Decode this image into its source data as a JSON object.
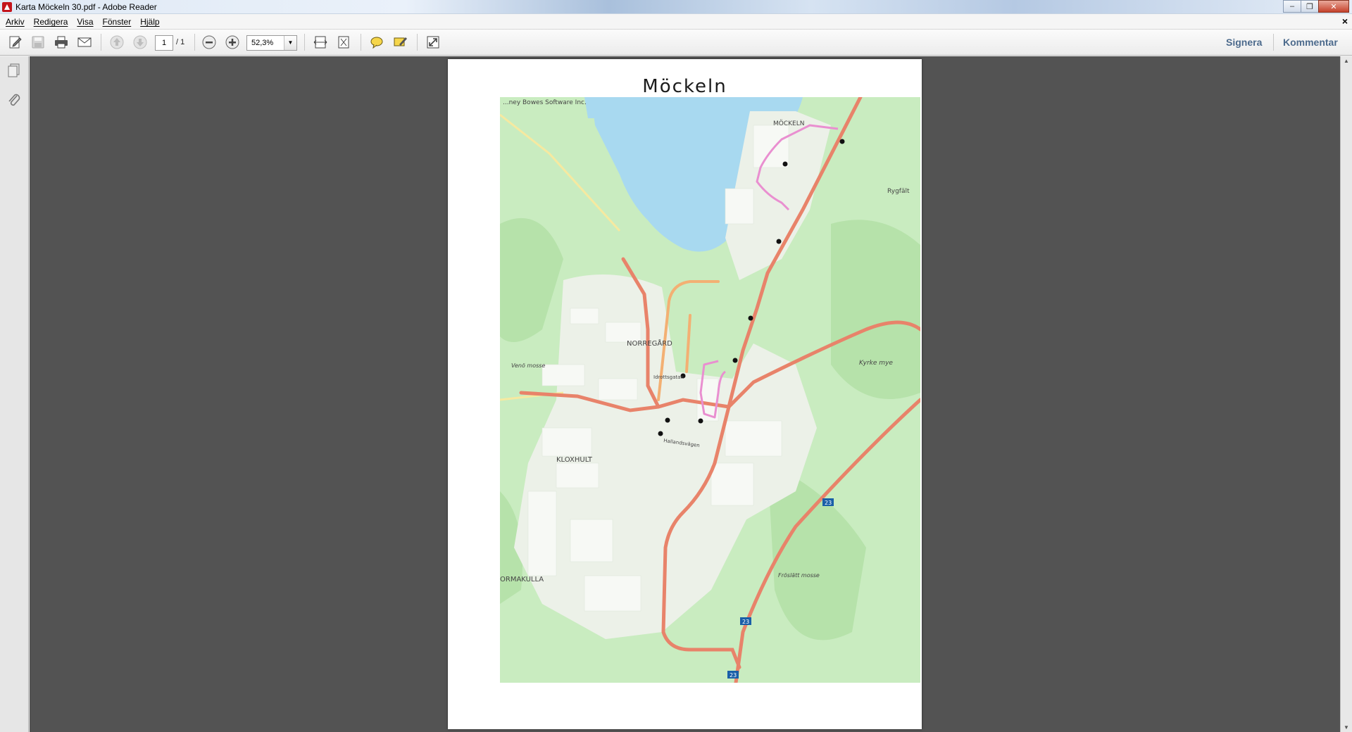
{
  "window": {
    "title": "Karta Möckeln 30.pdf - Adobe Reader",
    "controls": {
      "minimize": "–",
      "restore": "❐",
      "close": "✕"
    }
  },
  "menu": {
    "items": [
      "Arkiv",
      "Redigera",
      "Visa",
      "Fönster",
      "Hjälp"
    ],
    "doc_close": "×"
  },
  "toolbar": {
    "page_current": "1",
    "page_total": "/ 1",
    "zoom": "52,3%",
    "zoom_arrow": "▼",
    "sign": "Signera",
    "comment": "Kommentar"
  },
  "scrollbar": {
    "up": "▲",
    "down": "▼"
  },
  "document": {
    "title": "Möckeln",
    "map_labels": {
      "top_credit": "...ney Bowes Software Inc.",
      "mockeln": "MÖCKELN",
      "rygfalt": "Rygfält",
      "norregard": "NORREGÅRD",
      "kloxhult": "KLOXHULT",
      "ormakulla": "ORMAKULLA",
      "idrottsgatan": "Idrottsgatan",
      "hallandsvagen": "Hallandsvägen",
      "kyrke_mye": "Kyrke mye",
      "venomosse": "Venö mosse",
      "froslatt": "Fröslätt mosse",
      "route23": "23"
    }
  },
  "colors": {
    "accent": "#4c6a8c",
    "map_land": "#c9ecc0",
    "map_water": "#a8d9f0",
    "map_road_major": "#e8836a",
    "map_road_minor": "#f3b073",
    "map_route": "#e98fd0"
  }
}
